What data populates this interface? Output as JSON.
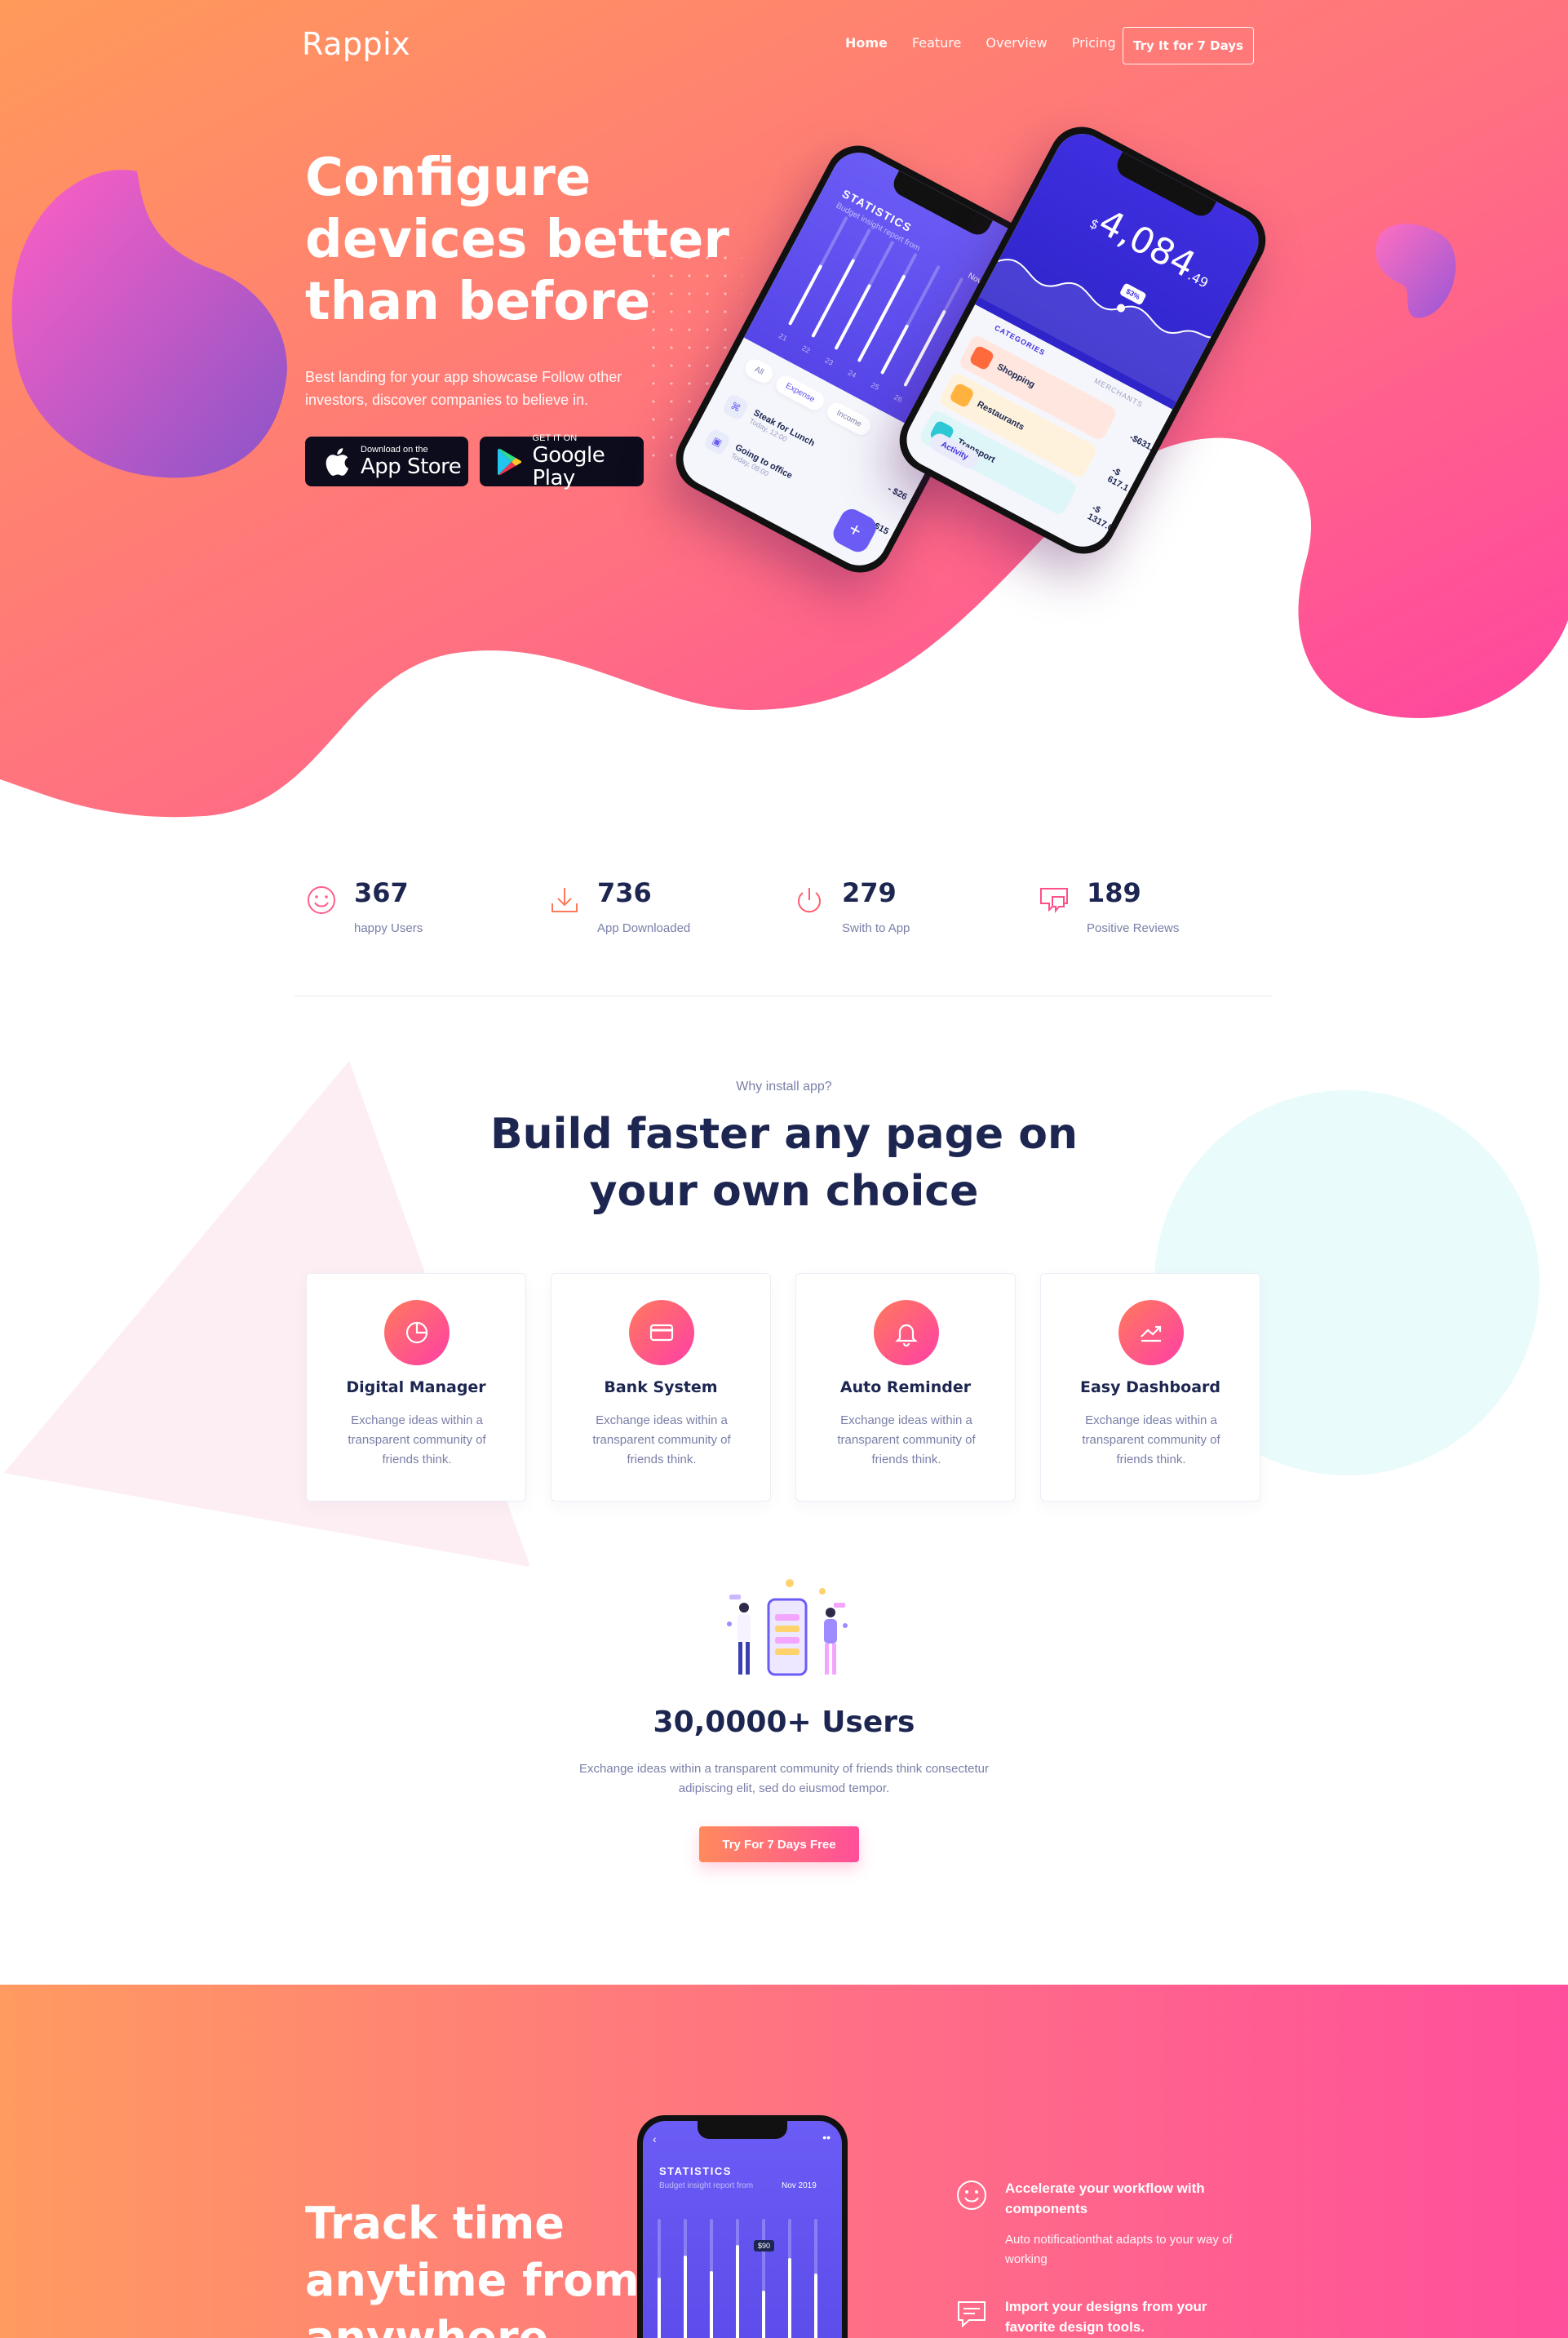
{
  "nav": {
    "logo": "Rappix",
    "links": [
      {
        "label": "Home",
        "active": true
      },
      {
        "label": "Feature",
        "active": false
      },
      {
        "label": "Overview",
        "active": false
      },
      {
        "label": "Pricing",
        "active": false
      }
    ],
    "cta": "Try It for 7 Days"
  },
  "hero": {
    "title": "Configure devices better than before",
    "subtitle": "Best landing for your app showcase Follow other investors, discover companies to believe in.",
    "app_store": {
      "small": "Download on the",
      "big": "App Store",
      "icon": "apple-icon"
    },
    "google_play": {
      "small": "GET IT ON",
      "big": "Google Play",
      "icon": "google-play-icon"
    },
    "colors": {
      "gradient_start": "#ff9a5a",
      "gradient_end": "#ff3fa4"
    }
  },
  "phone_stats": {
    "title": "STATISTICS",
    "subtitle": "Budget insight report from",
    "date": "Nov 2019",
    "tag": "$90",
    "bars": [
      {
        "x": "21",
        "level": 0.55
      },
      {
        "x": "22",
        "level": 0.72
      },
      {
        "x": "23",
        "level": 0.6
      },
      {
        "x": "24",
        "level": 0.8
      },
      {
        "x": "25",
        "level": 0.45
      },
      {
        "x": "26",
        "level": 0.7
      },
      {
        "x": "27",
        "level": 0.58
      }
    ],
    "chips": [
      "All",
      "Expense",
      "Income"
    ],
    "transactions": [
      {
        "name": "Steak for Lunch",
        "time": "Today, 12:00",
        "amount": "- $26"
      },
      {
        "name": "Going to office",
        "time": "Today, 08:00",
        "amount": "- $15"
      }
    ]
  },
  "phone_balance": {
    "amount": "4,084",
    "cents": ".49",
    "currency": "$",
    "badge": "$3%",
    "tabs": [
      "CATEGORIES",
      "MERCHANTS"
    ],
    "categories": [
      {
        "name": "Shopping",
        "amount": "-$631.6",
        "color": "#ff6a3d",
        "bg": "#ffe7df"
      },
      {
        "name": "Restaurants",
        "amount": "-$ 617.1",
        "color": "#ffb23d",
        "bg": "#fff2dc"
      },
      {
        "name": "Transport",
        "amount": "-$ 1317.6",
        "color": "#2ec7d6",
        "bg": "#dff6f8"
      }
    ],
    "activity": "Activity"
  },
  "stats": [
    {
      "value": "367",
      "label": "happy Users",
      "icon": "smile-icon"
    },
    {
      "value": "736",
      "label": "App Downloaded",
      "icon": "download-icon"
    },
    {
      "value": "279",
      "label": "Swith to App",
      "icon": "power-icon"
    },
    {
      "value": "189",
      "label": "Positive Reviews",
      "icon": "chat-review-icon"
    }
  ],
  "why": {
    "eyebrow": "Why install app?",
    "title": "Build faster any page on your own choice",
    "features": [
      {
        "title": "Digital Manager",
        "desc": "Exchange ideas within a transparent community of friends think.",
        "icon": "pie-chart-icon"
      },
      {
        "title": "Bank System",
        "desc": "Exchange ideas within a transparent community of friends think.",
        "icon": "credit-card-icon"
      },
      {
        "title": "Auto Reminder",
        "desc": "Exchange ideas within a transparent community of friends think.",
        "icon": "bell-icon"
      },
      {
        "title": "Easy Dashboard",
        "desc": "Exchange ideas within a transparent community of friends think.",
        "icon": "trend-up-icon"
      }
    ]
  },
  "users": {
    "title": "30,0000+ Users",
    "desc": "Exchange ideas within a transparent community of friends think consectetur adipiscing elit, sed do eiusmod tempor.",
    "cta": "Try For 7 Days Free"
  },
  "track": {
    "title": "Track time anytime from anywhere",
    "phone": {
      "title": "STATISTICS",
      "subtitle": "Budget insight report from",
      "date": "Nov 2019",
      "tag": "$90"
    },
    "features": [
      {
        "title": "Accelerate your workflow with components",
        "desc": "Auto notificationthat adapts to your way of working",
        "icon": "smile-icon"
      },
      {
        "title": "Import your designs from your favorite design tools.",
        "desc": "",
        "icon": "chat-icon"
      }
    ]
  }
}
